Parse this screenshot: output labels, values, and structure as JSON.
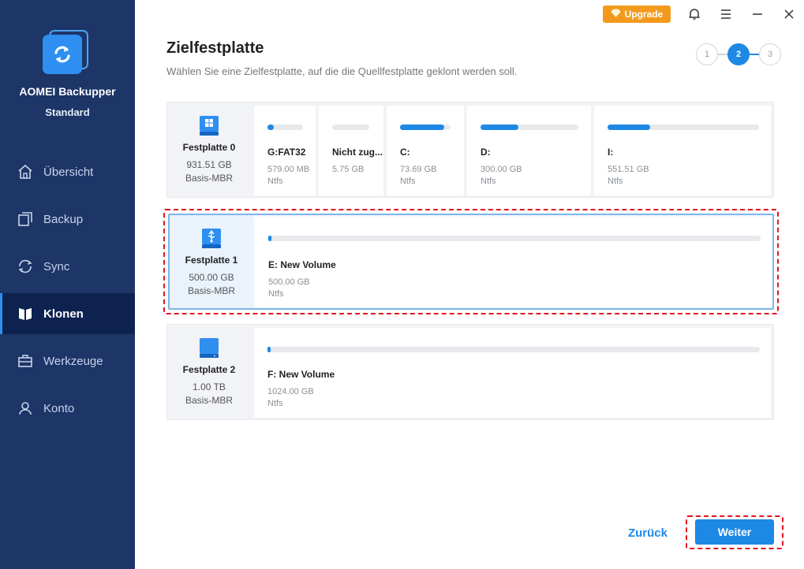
{
  "app": {
    "name": "AOMEI Backupper",
    "edition": "Standard"
  },
  "sidebar": {
    "items": [
      {
        "label": "Übersicht",
        "icon": "home-icon",
        "active": false
      },
      {
        "label": "Backup",
        "icon": "backup-icon",
        "active": false
      },
      {
        "label": "Sync",
        "icon": "sync-icon",
        "active": false
      },
      {
        "label": "Klonen",
        "icon": "clone-icon",
        "active": true
      },
      {
        "label": "Werkzeuge",
        "icon": "toolbox-icon",
        "active": false
      },
      {
        "label": "Konto",
        "icon": "user-icon",
        "active": false
      }
    ]
  },
  "topbar": {
    "upgrade_label": "Upgrade"
  },
  "header": {
    "title": "Zielfestplatte",
    "subtitle": "Wählen Sie eine Zielfestplatte, auf die die Quellfestplatte geklont werden soll."
  },
  "steps": [
    "1",
    "2",
    "3"
  ],
  "current_step": 2,
  "disks": [
    {
      "name": "Festplatte 0",
      "size": "931.51 GB",
      "type": "Basis-MBR",
      "kind": "system",
      "partitions": [
        {
          "name": "G:FAT32",
          "size": "579.00 MB",
          "fs": "Ntfs",
          "used": 0.18
        },
        {
          "name": "Nicht zug...",
          "size": "5.75 GB",
          "fs": "",
          "used": 0
        },
        {
          "name": "C:",
          "size": "73.69 GB",
          "fs": "Ntfs",
          "used": 0.88
        },
        {
          "name": "D:",
          "size": "300.00 GB",
          "fs": "Ntfs",
          "used": 0.39
        },
        {
          "name": "I:",
          "size": "551.51 GB",
          "fs": "Ntfs",
          "used": 0.28
        }
      ]
    },
    {
      "name": "Festplatte 1",
      "size": "500.00 GB",
      "type": "Basis-MBR",
      "kind": "usb",
      "selected": true,
      "partitions": [
        {
          "name": "E: New Volume",
          "size": "500.00 GB",
          "fs": "Ntfs",
          "used": 0.006
        }
      ]
    },
    {
      "name": "Festplatte 2",
      "size": "1.00 TB",
      "type": "Basis-MBR",
      "kind": "disk",
      "partitions": [
        {
          "name": "F: New Volume",
          "size": "1024.00 GB",
          "fs": "Ntfs",
          "used": 0.006
        }
      ]
    }
  ],
  "footer": {
    "back_label": "Zurück",
    "next_label": "Weiter"
  },
  "colors": {
    "sidebar": "#1d3567",
    "accent": "#1e88e5",
    "upgrade": "#f39a1d",
    "highlight": "#e0141e"
  }
}
